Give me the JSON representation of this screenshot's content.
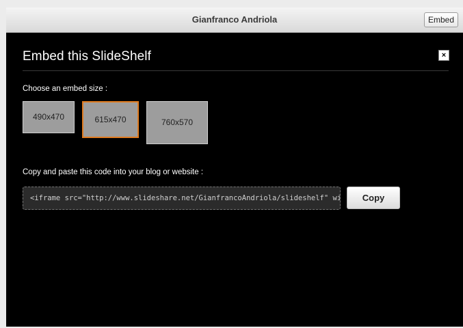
{
  "header": {
    "title": "Gianfranco Andriola",
    "embed_button": "Embed"
  },
  "modal": {
    "title": "Embed this SlideShelf",
    "close_icon": "close-icon",
    "close_glyph": "×",
    "size_label": "Choose an embed size :",
    "sizes": [
      {
        "label": "490x470",
        "selected": false
      },
      {
        "label": "615x470",
        "selected": true
      },
      {
        "label": "760x570",
        "selected": false
      }
    ],
    "code_label": "Copy and paste this code into your blog or website :",
    "code_value": "<iframe src=\"http://www.slideshare.net/GianfrancoAndriola/slideshelf\" wi",
    "copy_button": "Copy"
  },
  "colors": {
    "modal_background": "#000000",
    "selected_border": "#e07b1f",
    "size_option_bg": "#9d9d9d"
  }
}
